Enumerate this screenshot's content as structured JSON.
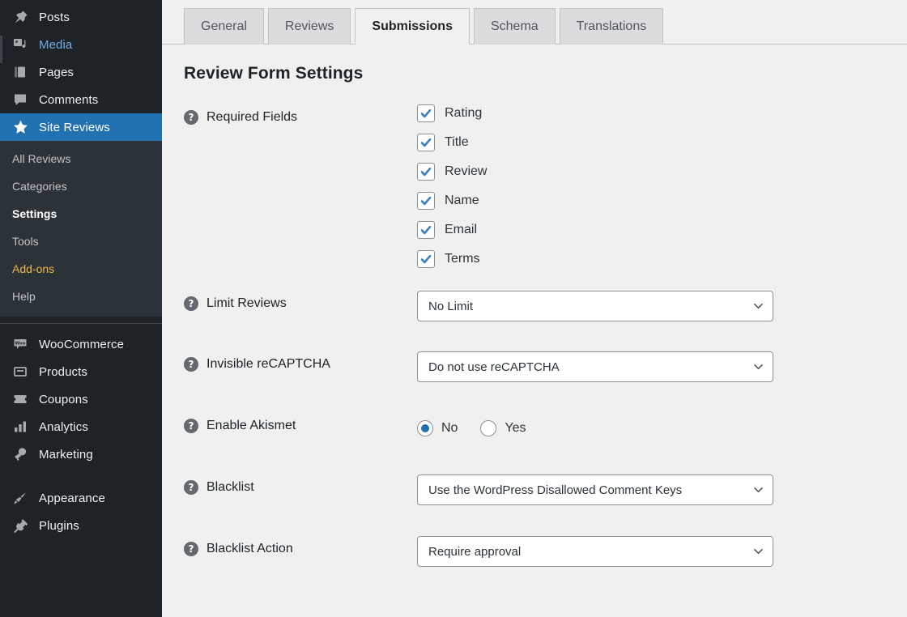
{
  "sidebar": {
    "top_items": [
      {
        "label": "Posts",
        "icon": "pin-icon",
        "state": "normal"
      },
      {
        "label": "Media",
        "icon": "media-icon",
        "state": "link"
      },
      {
        "label": "Pages",
        "icon": "pages-icon",
        "state": "normal"
      },
      {
        "label": "Comments",
        "icon": "comment-icon",
        "state": "normal"
      },
      {
        "label": "Site Reviews",
        "icon": "star-icon",
        "state": "current"
      }
    ],
    "submenu": [
      {
        "label": "All Reviews",
        "state": "normal"
      },
      {
        "label": "Categories",
        "state": "normal"
      },
      {
        "label": "Settings",
        "state": "current"
      },
      {
        "label": "Tools",
        "state": "normal"
      },
      {
        "label": "Add-ons",
        "state": "accent"
      },
      {
        "label": "Help",
        "state": "normal"
      }
    ],
    "woo_items": [
      {
        "label": "WooCommerce",
        "icon": "woo-icon"
      },
      {
        "label": "Products",
        "icon": "products-icon"
      },
      {
        "label": "Coupons",
        "icon": "coupon-icon"
      },
      {
        "label": "Analytics",
        "icon": "chart-icon"
      },
      {
        "label": "Marketing",
        "icon": "megaphone-icon"
      }
    ],
    "bottom_items": [
      {
        "label": "Appearance",
        "icon": "brush-icon"
      },
      {
        "label": "Plugins",
        "icon": "plug-icon"
      }
    ],
    "colors": {
      "menu_bg": "#1d2327",
      "submenu_bg": "#2c3338",
      "current": "#2271b1",
      "accent": "#f0b849",
      "link": "#72aee6"
    }
  },
  "tabs": [
    {
      "label": "General",
      "active": false
    },
    {
      "label": "Reviews",
      "active": false
    },
    {
      "label": "Submissions",
      "active": true
    },
    {
      "label": "Schema",
      "active": false
    },
    {
      "label": "Translations",
      "active": false
    }
  ],
  "page": {
    "section_title": "Review Form Settings",
    "help_glyph": "?"
  },
  "settings": [
    {
      "name": "required-fields",
      "label": "Required Fields",
      "type": "checkboxes",
      "options": [
        {
          "label": "Rating",
          "checked": true
        },
        {
          "label": "Title",
          "checked": true
        },
        {
          "label": "Review",
          "checked": true
        },
        {
          "label": "Name",
          "checked": true
        },
        {
          "label": "Email",
          "checked": true
        },
        {
          "label": "Terms",
          "checked": true
        }
      ]
    },
    {
      "name": "limit-reviews",
      "label": "Limit Reviews",
      "type": "select",
      "value": "No Limit"
    },
    {
      "name": "invisible-recaptcha",
      "label": "Invisible reCAPTCHA",
      "type": "select",
      "value": "Do not use reCAPTCHA"
    },
    {
      "name": "enable-akismet",
      "label": "Enable Akismet",
      "type": "radio",
      "options": [
        {
          "label": "No",
          "selected": true
        },
        {
          "label": "Yes",
          "selected": false
        }
      ]
    },
    {
      "name": "blacklist",
      "label": "Blacklist",
      "type": "select",
      "value": "Use the WordPress Disallowed Comment Keys"
    },
    {
      "name": "blacklist-action",
      "label": "Blacklist Action",
      "type": "select",
      "value": "Require approval"
    }
  ]
}
